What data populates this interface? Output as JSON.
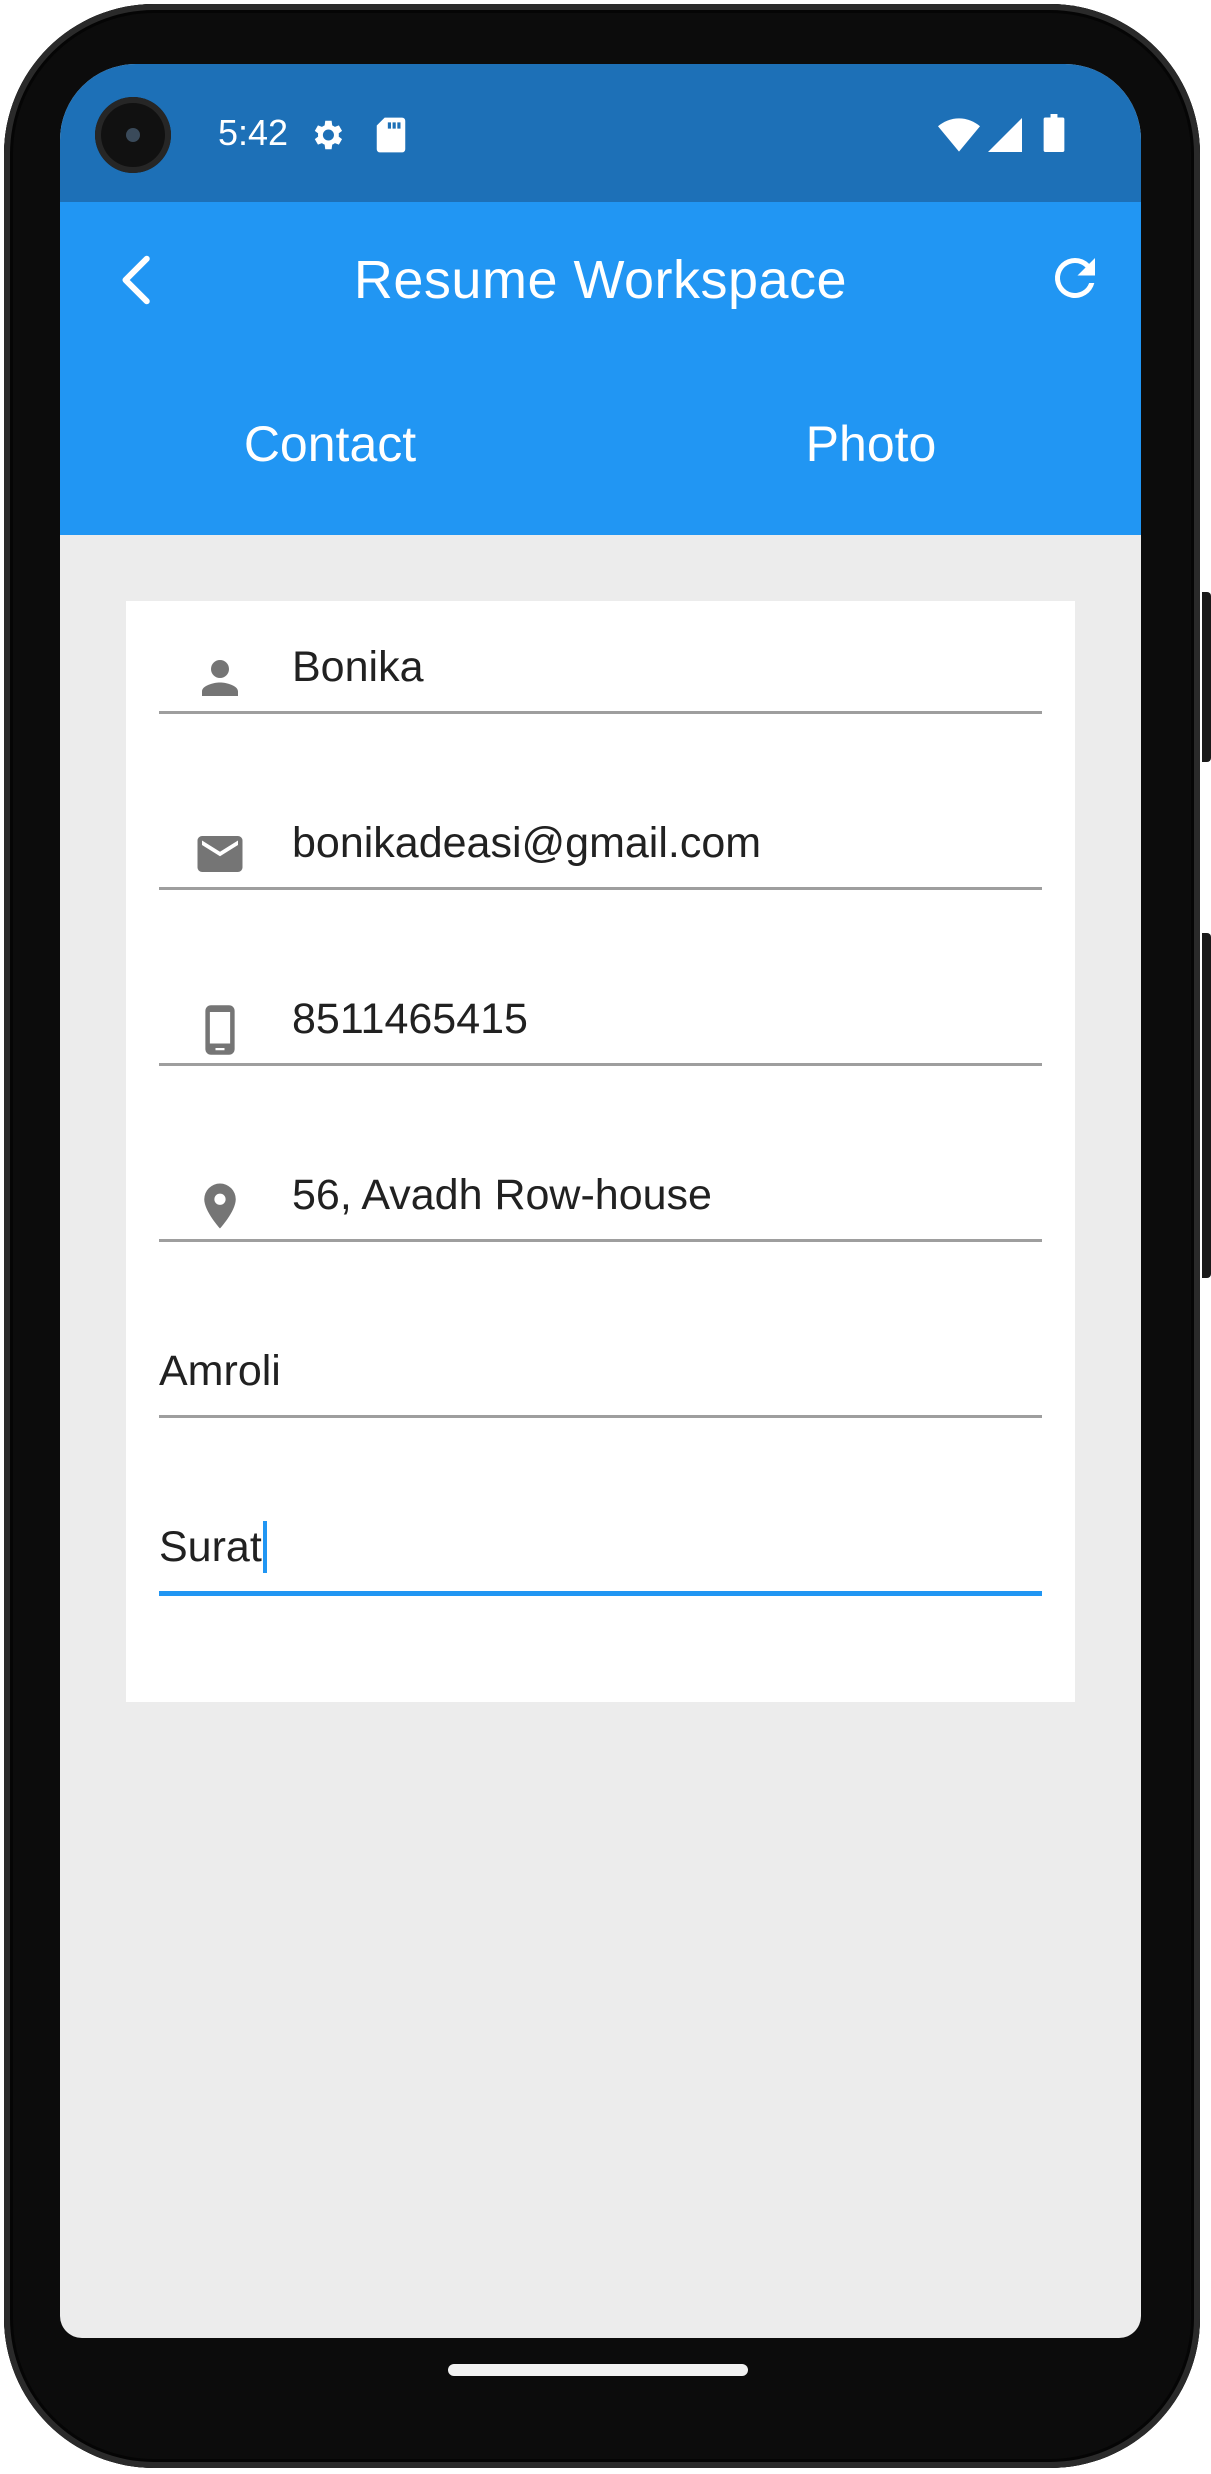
{
  "status_bar": {
    "time": "5:42",
    "icons": [
      "settings-icon",
      "sd-card-icon",
      "wifi-icon",
      "cell-signal-icon",
      "battery-icon"
    ]
  },
  "app_bar": {
    "title": "Resume Workspace",
    "back_icon": "back-chevron-icon",
    "refresh_icon": "refresh-icon",
    "background_color": "#2196f3"
  },
  "tabs": [
    {
      "label": "Contact"
    },
    {
      "label": "Photo"
    }
  ],
  "form": {
    "fields": [
      {
        "icon": "person-icon",
        "value": "Bonika"
      },
      {
        "icon": "email-icon",
        "value": "bonikadeasi@gmail.com"
      },
      {
        "icon": "phone-icon",
        "value": "8511465415"
      },
      {
        "icon": "location-icon",
        "value": "56, Avadh Row-house"
      },
      {
        "icon": "",
        "value": "Amroli"
      },
      {
        "icon": "",
        "value": "Surat",
        "focused": true
      }
    ],
    "accent_color": "#2196f3"
  }
}
